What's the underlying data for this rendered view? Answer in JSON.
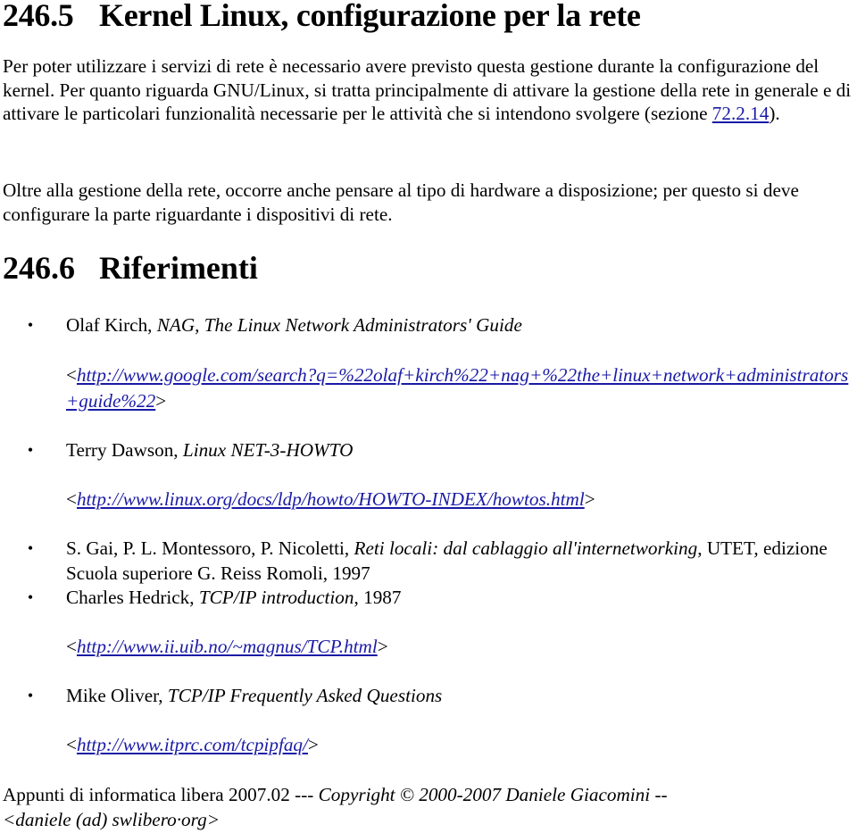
{
  "section1": {
    "number": "246.5",
    "title": "Kernel Linux, configurazione per la rete",
    "paragraph1_before_link": "Per poter utilizzare i servizi di rete è necessario avere previsto questa gestione durante la configurazione del kernel. Per quanto riguarda GNU/Linux, si tratta principalmente di attivare la gestione della rete in generale e di attivare le particolari funzionalità necessarie per le attività che si intendono svolgere (sezione ",
    "paragraph1_link": "72.2.14",
    "paragraph1_after_link": ").",
    "paragraph2": "Oltre alla gestione della rete, occorre anche pensare al tipo di hardware a disposizione; per questo si deve configurare la parte riguardante i dispositivi di rete."
  },
  "section2": {
    "number": "246.6",
    "title": "Riferimenti"
  },
  "references": [
    {
      "author": "Olaf Kirch, ",
      "title": "NAG, The Linux Network Administrators' Guide",
      "after": "",
      "url": "http://www.google.com/search?q=%22olaf+kirch%22+nag+%22the+linux+network+administrators+guide%22"
    },
    {
      "author": "Terry Dawson, ",
      "title": "Linux NET-3-HOWTO",
      "after": "",
      "url": "http://www.linux.org/docs/ldp/howto/HOWTO-INDEX/howtos.html"
    },
    {
      "author": "S. Gai, P. L. Montessoro, P. Nicoletti, ",
      "title": "Reti locali: dal cablaggio all'internetworking",
      "after": ", UTET, edizione Scuola superiore G. Reiss Romoli, 1997",
      "url": ""
    },
    {
      "author": "Charles Hedrick, ",
      "title": "TCP/IP introduction",
      "after": ", 1987",
      "url": "http://www.ii.uib.no/~magnus/TCP.html"
    },
    {
      "author": "Mike Oliver, ",
      "title": "TCP/IP Frequently Asked Questions",
      "after": "",
      "url": "http://www.itprc.com/tcpipfaq/"
    }
  ],
  "url_open": "<",
  "url_close": ">",
  "bullet": "•",
  "footer": {
    "text": "Appunti di informatica libera 2007.02 --- ",
    "copyright": "Copyright © 2000-2007 Daniele Giacomini --",
    "email": "<daniele (ad) swlibero·org>"
  }
}
